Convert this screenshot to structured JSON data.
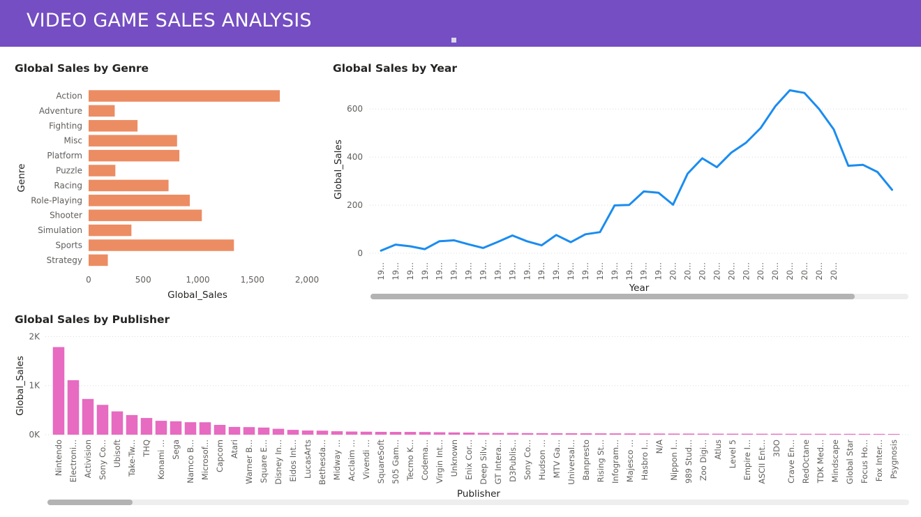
{
  "header": {
    "title": "VIDEO GAME SALES ANALYSIS",
    "accent_color": "#744EC2"
  },
  "colors": {
    "genre_bar": "#EC8C63",
    "year_line": "#1A8CF0",
    "publisher_bar": "#E66BC1"
  },
  "chart_data": [
    {
      "type": "bar",
      "orientation": "horizontal",
      "title": "Global Sales by Genre",
      "xlabel": "Global_Sales",
      "ylabel": "Genre",
      "xlim": [
        0,
        2000
      ],
      "xticks": [
        0,
        500,
        1000,
        1500,
        2000
      ],
      "xtick_labels": [
        "0",
        "500",
        "1,000",
        "1,500",
        "2,000"
      ],
      "grid": false,
      "categories": [
        "Action",
        "Adventure",
        "Fighting",
        "Misc",
        "Platform",
        "Puzzle",
        "Racing",
        "Role-Playing",
        "Shooter",
        "Simulation",
        "Sports",
        "Strategy"
      ],
      "values": [
        1751,
        239,
        448,
        810,
        831,
        245,
        732,
        927,
        1037,
        392,
        1331,
        176
      ]
    },
    {
      "type": "line",
      "title": "Global Sales by Year",
      "xlabel": "Year",
      "ylabel": "Global_Sales",
      "ylim": [
        0,
        700
      ],
      "yticks": [
        0,
        200,
        400,
        600
      ],
      "grid": true,
      "x": [
        "1980",
        "1981",
        "1982",
        "1983",
        "1984",
        "1985",
        "1986",
        "1987",
        "1988",
        "1989",
        "1990",
        "1991",
        "1992",
        "1993",
        "1994",
        "1995",
        "1996",
        "1997",
        "1998",
        "1999",
        "2000",
        "2001",
        "2002",
        "2003",
        "2004",
        "2005",
        "2006",
        "2007",
        "2008",
        "2009",
        "2010",
        "2011",
        "2012",
        "2013",
        "2014",
        "2015",
        "2016",
        "2017"
      ],
      "x_tick_labels": [
        "19...",
        "19...",
        "19...",
        "19...",
        "19...",
        "19...",
        "19...",
        "19...",
        "19...",
        "19...",
        "19...",
        "19...",
        "19...",
        "19...",
        "19...",
        "19...",
        "19...",
        "19...",
        "19...",
        "19...",
        "20...",
        "20...",
        "20...",
        "20...",
        "20...",
        "20...",
        "20...",
        "20...",
        "20...",
        "20...",
        "20...",
        "20..."
      ],
      "values": [
        11,
        36,
        29,
        17,
        50,
        54,
        37,
        22,
        47,
        74,
        50,
        33,
        76,
        46,
        79,
        88,
        199,
        201,
        257,
        252,
        202,
        331,
        395,
        358,
        419,
        460,
        521,
        611,
        678,
        667,
        600,
        516,
        364,
        368,
        338,
        264
      ],
      "visible_points": 32
    },
    {
      "type": "bar",
      "title": "Global Sales by Publisher",
      "xlabel": "Publisher",
      "ylabel": "Global_Sales",
      "ylim": [
        0,
        2000
      ],
      "yticks": [
        0,
        1000,
        2000
      ],
      "ytick_labels": [
        "0K",
        "1K",
        "2K"
      ],
      "grid": true,
      "categories": [
        "Nintendo",
        "Electroni...",
        "Activision",
        "Sony Co...",
        "Ubisoft",
        "Take-Tw...",
        "THQ",
        "Konami ...",
        "Sega",
        "Namco B...",
        "Microsof...",
        "Capcom",
        "Atari",
        "Warner B...",
        "Square E...",
        "Disney In...",
        "Eidos Int...",
        "LucasArts",
        "Bethesda...",
        "Midway ...",
        "Acclaim ...",
        "Vivendi ...",
        "SquareSoft",
        "505 Gam...",
        "Tecmo K...",
        "Codema...",
        "Virgin Int...",
        "Unknown",
        "Enix Cor...",
        "Deep Silv...",
        "GT Intera...",
        "D3Publis...",
        "Sony Co...",
        "Hudson ...",
        "MTV Ga...",
        "Universal...",
        "Banpresto",
        "Rising St...",
        "Infogram...",
        "Majesco ...",
        "Hasbro I...",
        "N/A",
        "Nippon I...",
        "989 Stud...",
        "Zoo Digi...",
        "Atlus",
        "Level 5",
        "Empire I...",
        "ASCII Ent...",
        "3DO",
        "Crave En...",
        "RedOctane",
        "TDK Med...",
        "Mindscape",
        "Global Star",
        "Focus Ho...",
        "Fox Inter...",
        "Psygnosis"
      ],
      "values": [
        1786,
        1111,
        728,
        608,
        475,
        400,
        340,
        283,
        273,
        254,
        253,
        200,
        158,
        154,
        145,
        120,
        98,
        85,
        82,
        70,
        64,
        61,
        58,
        56,
        56,
        54,
        49,
        46,
        43,
        37,
        35,
        35,
        32,
        31,
        30,
        29,
        28,
        27,
        26,
        25,
        24,
        23,
        22,
        22,
        21,
        20,
        20,
        20,
        19,
        19,
        18,
        18,
        18,
        17,
        17,
        17,
        16,
        15
      ]
    }
  ]
}
